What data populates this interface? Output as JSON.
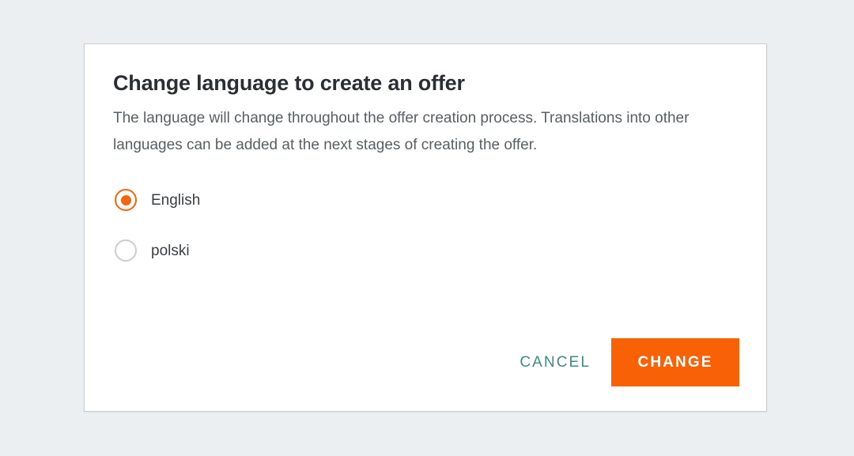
{
  "dialog": {
    "title": "Change language to create an offer",
    "description": "The language will change throughout the offer creation process. Translations into other languages can be added at the next stages of creating the offer.",
    "options": [
      {
        "label": "English",
        "selected": true
      },
      {
        "label": "polski",
        "selected": false
      }
    ],
    "actions": {
      "cancel_label": "CANCEL",
      "confirm_label": "CHANGE"
    }
  },
  "colors": {
    "page_background": "#ebeff2",
    "card_background": "#ffffff",
    "card_border": "#c9ced3",
    "title_text": "#2b2f33",
    "body_text": "#585f63",
    "label_text": "#3a4045",
    "accent_orange": "#f96107",
    "radio_selected": "#f4650c",
    "radio_unselected": "#cbcdcf",
    "cancel_teal": "#3c8c7e",
    "confirm_text": "#ffffff"
  }
}
